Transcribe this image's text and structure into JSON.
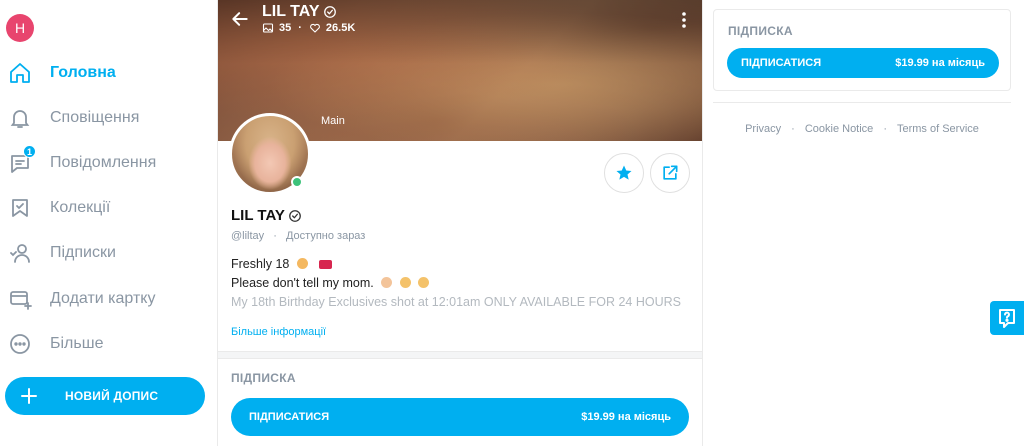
{
  "user": {
    "initial": "H"
  },
  "nav": {
    "items": [
      {
        "label": "Головна",
        "icon": "home-icon",
        "active": true
      },
      {
        "label": "Сповіщення",
        "icon": "bell-icon",
        "active": false
      },
      {
        "label": "Повідомлення",
        "icon": "message-icon",
        "active": false,
        "badge": "1"
      },
      {
        "label": "Колекції",
        "icon": "bookmark-icon",
        "active": false
      },
      {
        "label": "Підписки",
        "icon": "users-icon",
        "active": false
      },
      {
        "label": "Додати картку",
        "icon": "card-icon",
        "active": false
      },
      {
        "label": "Більше",
        "icon": "more-icon",
        "active": false
      }
    ],
    "new_post_label": "НОВИЙ ДОПИС"
  },
  "profile": {
    "cover_name": "LIL TAY",
    "media_count": "35",
    "likes_count": "26.5K",
    "cover_tag": "Main",
    "name": "LIL TAY",
    "handle": "@liltay",
    "status": "Доступно зараз",
    "bio_lines": [
      "Freshly 18",
      "Please don't tell my mom.",
      "My 18th Birthday Exclusives shot at 12:01am ONLY AVAILABLE FOR 24 HOURS"
    ],
    "more_info_label": "Більше інформації"
  },
  "subscription": {
    "section_title": "ПІДПИСКА",
    "button_label": "ПІДПИСАТИСЯ",
    "price": "$19.99 на місяць"
  },
  "footer": {
    "links": [
      "Privacy",
      "Cookie Notice",
      "Terms of Service"
    ]
  },
  "colors": {
    "accent": "#00aff0",
    "muted": "#8a96a3",
    "online": "#3dc27a",
    "avatar_bg": "#e8456e"
  }
}
